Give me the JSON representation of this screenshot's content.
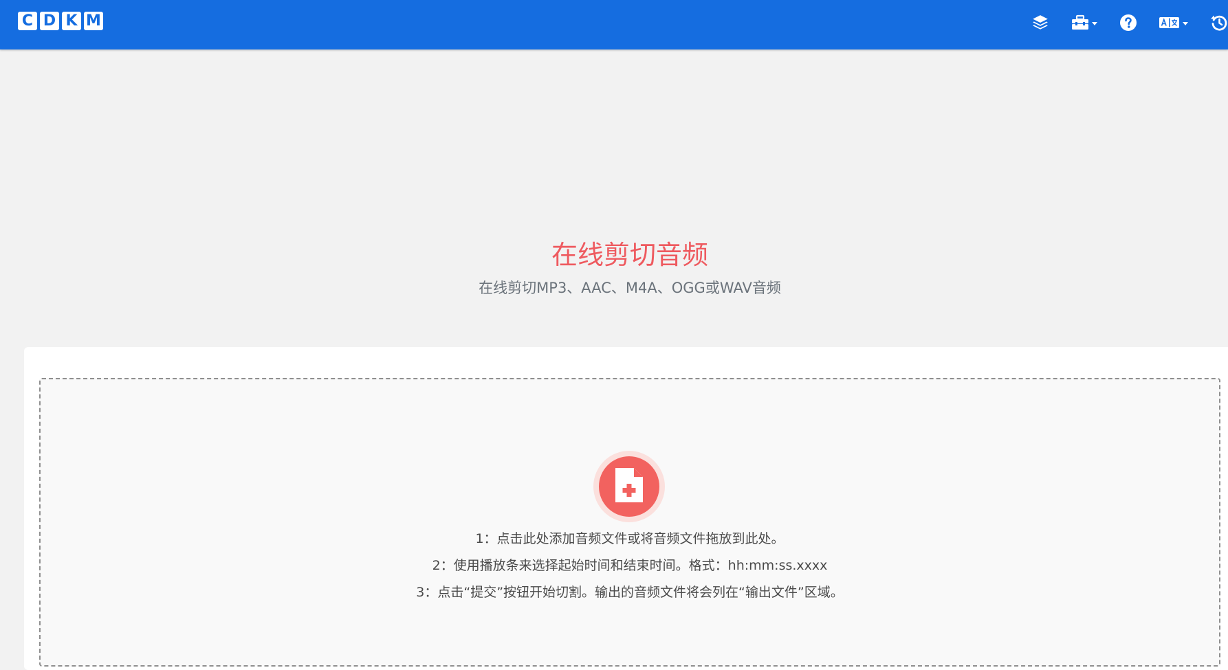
{
  "brand": {
    "letters": [
      "C",
      "D",
      "K",
      "M"
    ]
  },
  "nav": {
    "icons": [
      {
        "name": "layers-icon"
      },
      {
        "name": "toolbox-icon",
        "has_caret": true
      },
      {
        "name": "help-icon"
      },
      {
        "name": "translate-icon",
        "has_caret": true
      },
      {
        "name": "history-icon"
      }
    ]
  },
  "hero": {
    "title": "在线剪切音频",
    "subtitle": "在线剪切MP3、AAC、M4A、OGG或WAV音频"
  },
  "upload": {
    "icon": "file-add-icon",
    "steps": [
      "1：点击此处添加音频文件或将音频文件拖放到此处。",
      "2：使用播放条来选择起始时间和结束时间。格式：hh:mm:ss.xxxx",
      "3：点击“提交”按钮开始切割。输出的音频文件将会列在“输出文件”区域。"
    ]
  },
  "colors": {
    "navbar": "#156de0",
    "accent": "#ee5a5f",
    "background": "#f2f2f2"
  }
}
